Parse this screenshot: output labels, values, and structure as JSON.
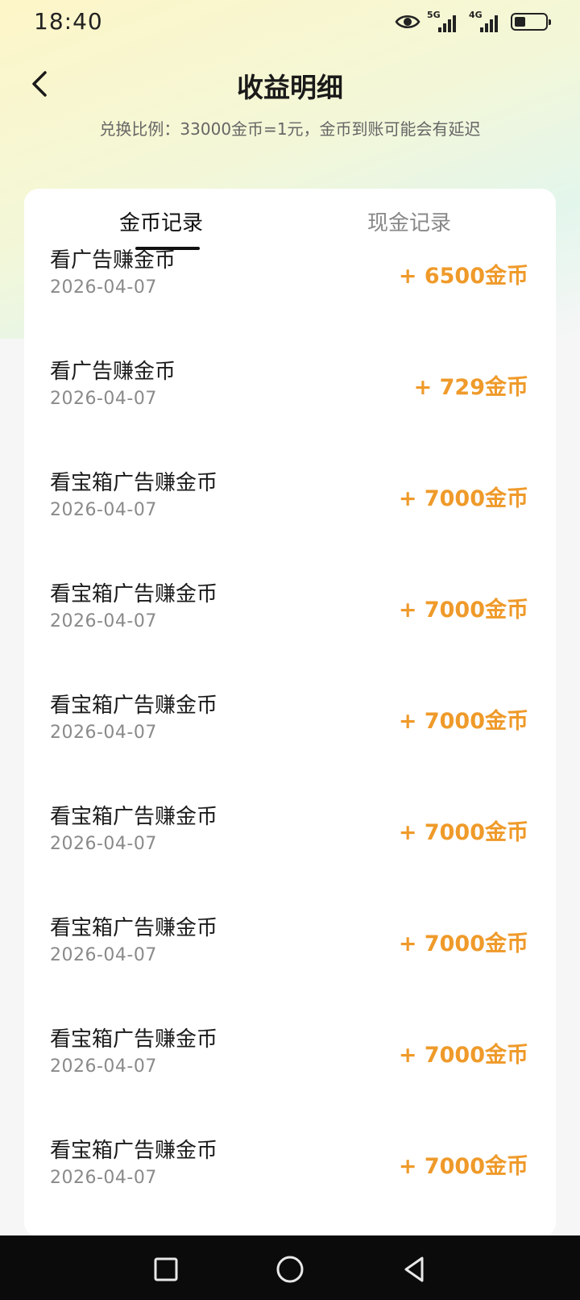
{
  "status_bar": {
    "time": "18:40",
    "network1": "5G",
    "network2": "4G"
  },
  "header": {
    "title": "收益明细",
    "subtitle": "兑换比例：33000金币=1元，金币到账可能会有延迟"
  },
  "tabs": [
    {
      "label": "金币记录",
      "active": true
    },
    {
      "label": "现金记录",
      "active": false
    }
  ],
  "records": [
    {
      "name": "看广告赚金币",
      "date": "2026-04-07",
      "amount": "+ 6500金币"
    },
    {
      "name": "看广告赚金币",
      "date": "2026-04-07",
      "amount": "+ 729金币"
    },
    {
      "name": "看宝箱广告赚金币",
      "date": "2026-04-07",
      "amount": "+ 7000金币"
    },
    {
      "name": "看宝箱广告赚金币",
      "date": "2026-04-07",
      "amount": "+ 7000金币"
    },
    {
      "name": "看宝箱广告赚金币",
      "date": "2026-04-07",
      "amount": "+ 7000金币"
    },
    {
      "name": "看宝箱广告赚金币",
      "date": "2026-04-07",
      "amount": "+ 7000金币"
    },
    {
      "name": "看宝箱广告赚金币",
      "date": "2026-04-07",
      "amount": "+ 7000金币"
    },
    {
      "name": "看宝箱广告赚金币",
      "date": "2026-04-07",
      "amount": "+ 7000金币"
    },
    {
      "name": "看宝箱广告赚金币",
      "date": "2026-04-07",
      "amount": "+ 7000金币"
    }
  ],
  "colors": {
    "accent": "#ef9a2a",
    "nav_bg": "#0b0b0b"
  },
  "icons": {
    "back": "chevron-left-icon",
    "eye": "eye-icon",
    "battery": "battery-icon",
    "nav": [
      "square-icon",
      "circle-icon",
      "triangle-back-icon"
    ]
  }
}
